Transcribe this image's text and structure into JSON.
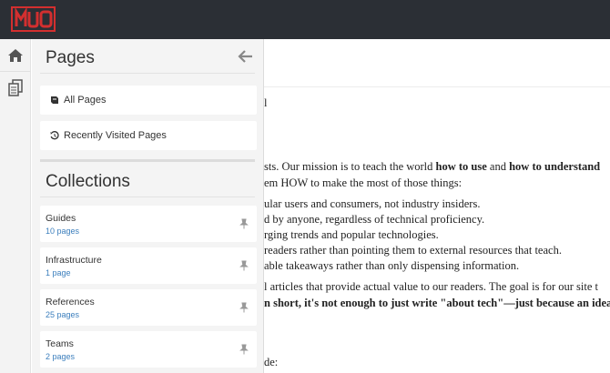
{
  "brand": {
    "logo_text": "MUO",
    "accent": "#d32f2f"
  },
  "sidebar_panel": {
    "title": "Pages",
    "pages": [
      {
        "label": "All Pages",
        "icon": "book-icon"
      },
      {
        "label": "Recently Visited Pages",
        "icon": "history-icon"
      }
    ],
    "collections_title": "Collections",
    "collections": [
      {
        "name": "Guides",
        "count": "10 pages"
      },
      {
        "name": "Infrastructure",
        "count": "1 page"
      },
      {
        "name": "References",
        "count": "25 pages"
      },
      {
        "name": "Teams",
        "count": "2 pages"
      }
    ]
  },
  "content": {
    "lines": [
      {
        "pre": "l",
        "b1": "",
        "mid": "",
        "b2": ""
      },
      {
        "pre": "sts. Our mission is to teach the world ",
        "b1": "how to use",
        "mid": " and ",
        "b2": "how to understand"
      },
      {
        "pre": "em HOW to make the most of those things:",
        "b1": "",
        "mid": "",
        "b2": ""
      },
      {
        "pre": "ular users and consumers, not industry insiders.",
        "b1": "",
        "mid": "",
        "b2": ""
      },
      {
        "pre": "d by anyone, regardless of technical proficiency.",
        "b1": "",
        "mid": "",
        "b2": ""
      },
      {
        "pre": "rging trends and popular technologies.",
        "b1": "",
        "mid": "",
        "b2": ""
      },
      {
        "pre": "readers rather than pointing them to external resources that teach.",
        "b1": "",
        "mid": "",
        "b2": ""
      },
      {
        "pre": "able takeaways rather than only dispensing information.",
        "b1": "",
        "mid": "",
        "b2": ""
      },
      {
        "pre": "l articles that provide actual value to our readers. The goal is for our site t",
        "b1": "",
        "mid": "",
        "b2": ""
      },
      {
        "pre": "",
        "b1": "n short, it's not enough to just write \"about tech\"—just because an idea i",
        "mid": "",
        "b2": ""
      },
      {
        "pre": "de:",
        "b1": "",
        "mid": "",
        "b2": ""
      }
    ]
  }
}
